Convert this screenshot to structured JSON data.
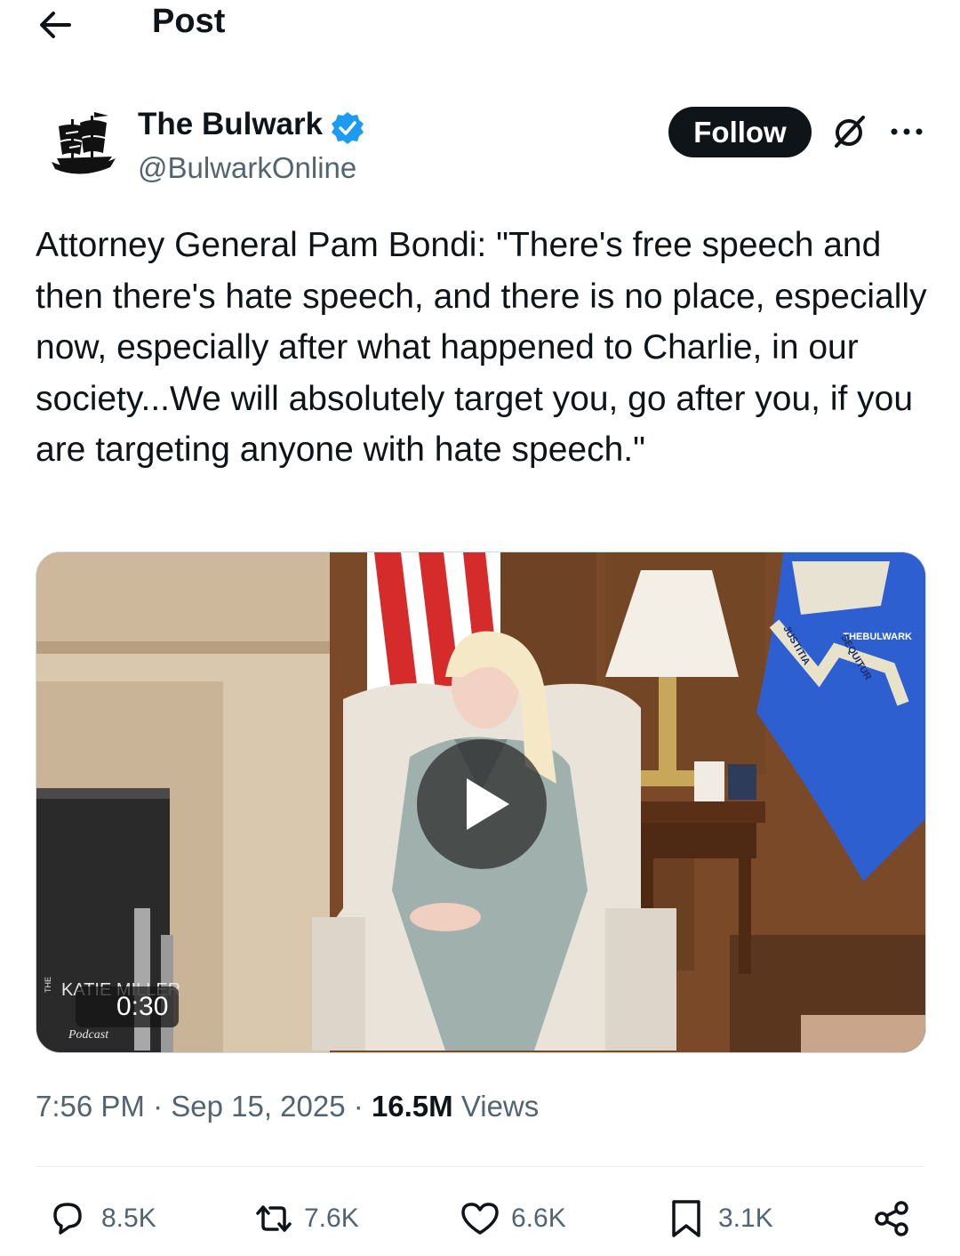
{
  "header": {
    "title": "Post"
  },
  "post": {
    "author": {
      "name": "The Bulwark",
      "handle": "@BulwarkOnline",
      "verified": true
    },
    "follow_label": "Follow",
    "text": "Attorney General Pam Bondi: \"There's free speech and then there's hate speech, and there is no place, especially now, especially after what happened to Charlie, in our society...We will absolutely target you, go after you, if you are targeting anyone with hate speech.\"",
    "video": {
      "duration": "0:30",
      "watermark_top": "THE",
      "watermark_name": "KATIE MILLER",
      "watermark_sub": "Podcast",
      "corner_watermark": "THEBULWARK",
      "flag_text_left": "JUSTITIA",
      "flag_text_right": "SEQUITUR"
    },
    "time": "7:56 PM",
    "date": "Sep 15, 2025",
    "views_count": "16.5M",
    "views_label": "Views"
  },
  "actions": {
    "replies": "8.5K",
    "reposts": "7.6K",
    "likes": "6.6K",
    "bookmarks": "3.1K"
  },
  "colors": {
    "accent": "#1d9bf0",
    "text": "#0f1419",
    "secondary": "#536471",
    "follow_bg": "#0f1419"
  }
}
